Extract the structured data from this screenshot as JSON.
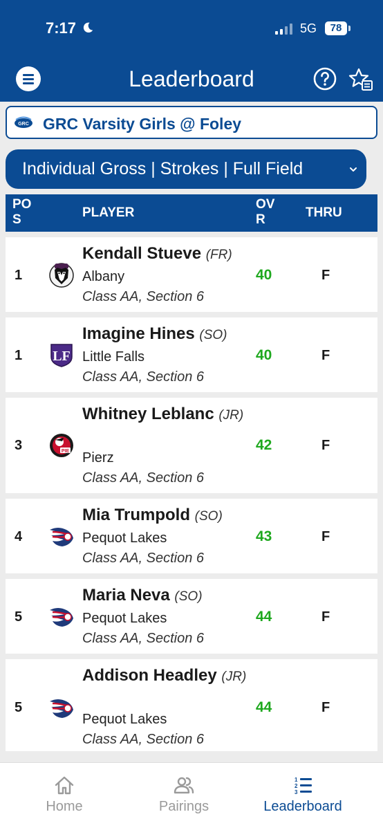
{
  "status_bar": {
    "time": "7:17",
    "network": "5G",
    "battery": "78"
  },
  "header": {
    "title": "Leaderboard"
  },
  "event": {
    "title": "GRC Varsity Girls @ Foley"
  },
  "filter": {
    "label": "Individual Gross | Strokes | Full Field"
  },
  "table": {
    "headers": {
      "pos": "POS",
      "player": "PLAYER",
      "ovr": "OVR",
      "thru": "THRU"
    },
    "rows": [
      {
        "pos": "1",
        "name": "Kendall Stueve",
        "year": "(FR)",
        "school": "Albany",
        "class": "Class AA, Section 6",
        "ovr": "40",
        "thru": "F",
        "logo": "albany-husky"
      },
      {
        "pos": "1",
        "name": "Imagine Hines",
        "year": "(SO)",
        "school": "Little Falls",
        "class": "Class AA, Section 6",
        "ovr": "40",
        "thru": "F",
        "logo": "little-falls-lf"
      },
      {
        "pos": "3",
        "name": "Whitney Leblanc",
        "year": "(JR)",
        "school": "Pierz",
        "class": "Class AA, Section 6",
        "ovr": "42",
        "thru": "F",
        "logo": "pierz-pioneer"
      },
      {
        "pos": "4",
        "name": "Mia Trumpold",
        "year": "(SO)",
        "school": "Pequot Lakes",
        "class": "Class AA, Section 6",
        "ovr": "43",
        "thru": "F",
        "logo": "pequot-lakes-patriot"
      },
      {
        "pos": "5",
        "name": "Maria Neva",
        "year": "(SO)",
        "school": "Pequot Lakes",
        "class": "Class AA, Section 6",
        "ovr": "44",
        "thru": "F",
        "logo": "pequot-lakes-patriot"
      },
      {
        "pos": "5",
        "name": "Addison Headley",
        "year": "(JR)",
        "school": "Pequot Lakes",
        "class": "Class AA, Section 6",
        "ovr": "44",
        "thru": "F",
        "logo": "pequot-lakes-patriot"
      }
    ]
  },
  "bottom_nav": [
    {
      "label": "Home",
      "icon": "home-icon",
      "active": false
    },
    {
      "label": "Pairings",
      "icon": "people-icon",
      "active": false
    },
    {
      "label": "Leaderboard",
      "icon": "ranked-list-icon",
      "active": true
    }
  ],
  "colors": {
    "primary": "#0b4b93",
    "score": "#1ea81e",
    "inactive_nav": "#9a9a9a"
  }
}
